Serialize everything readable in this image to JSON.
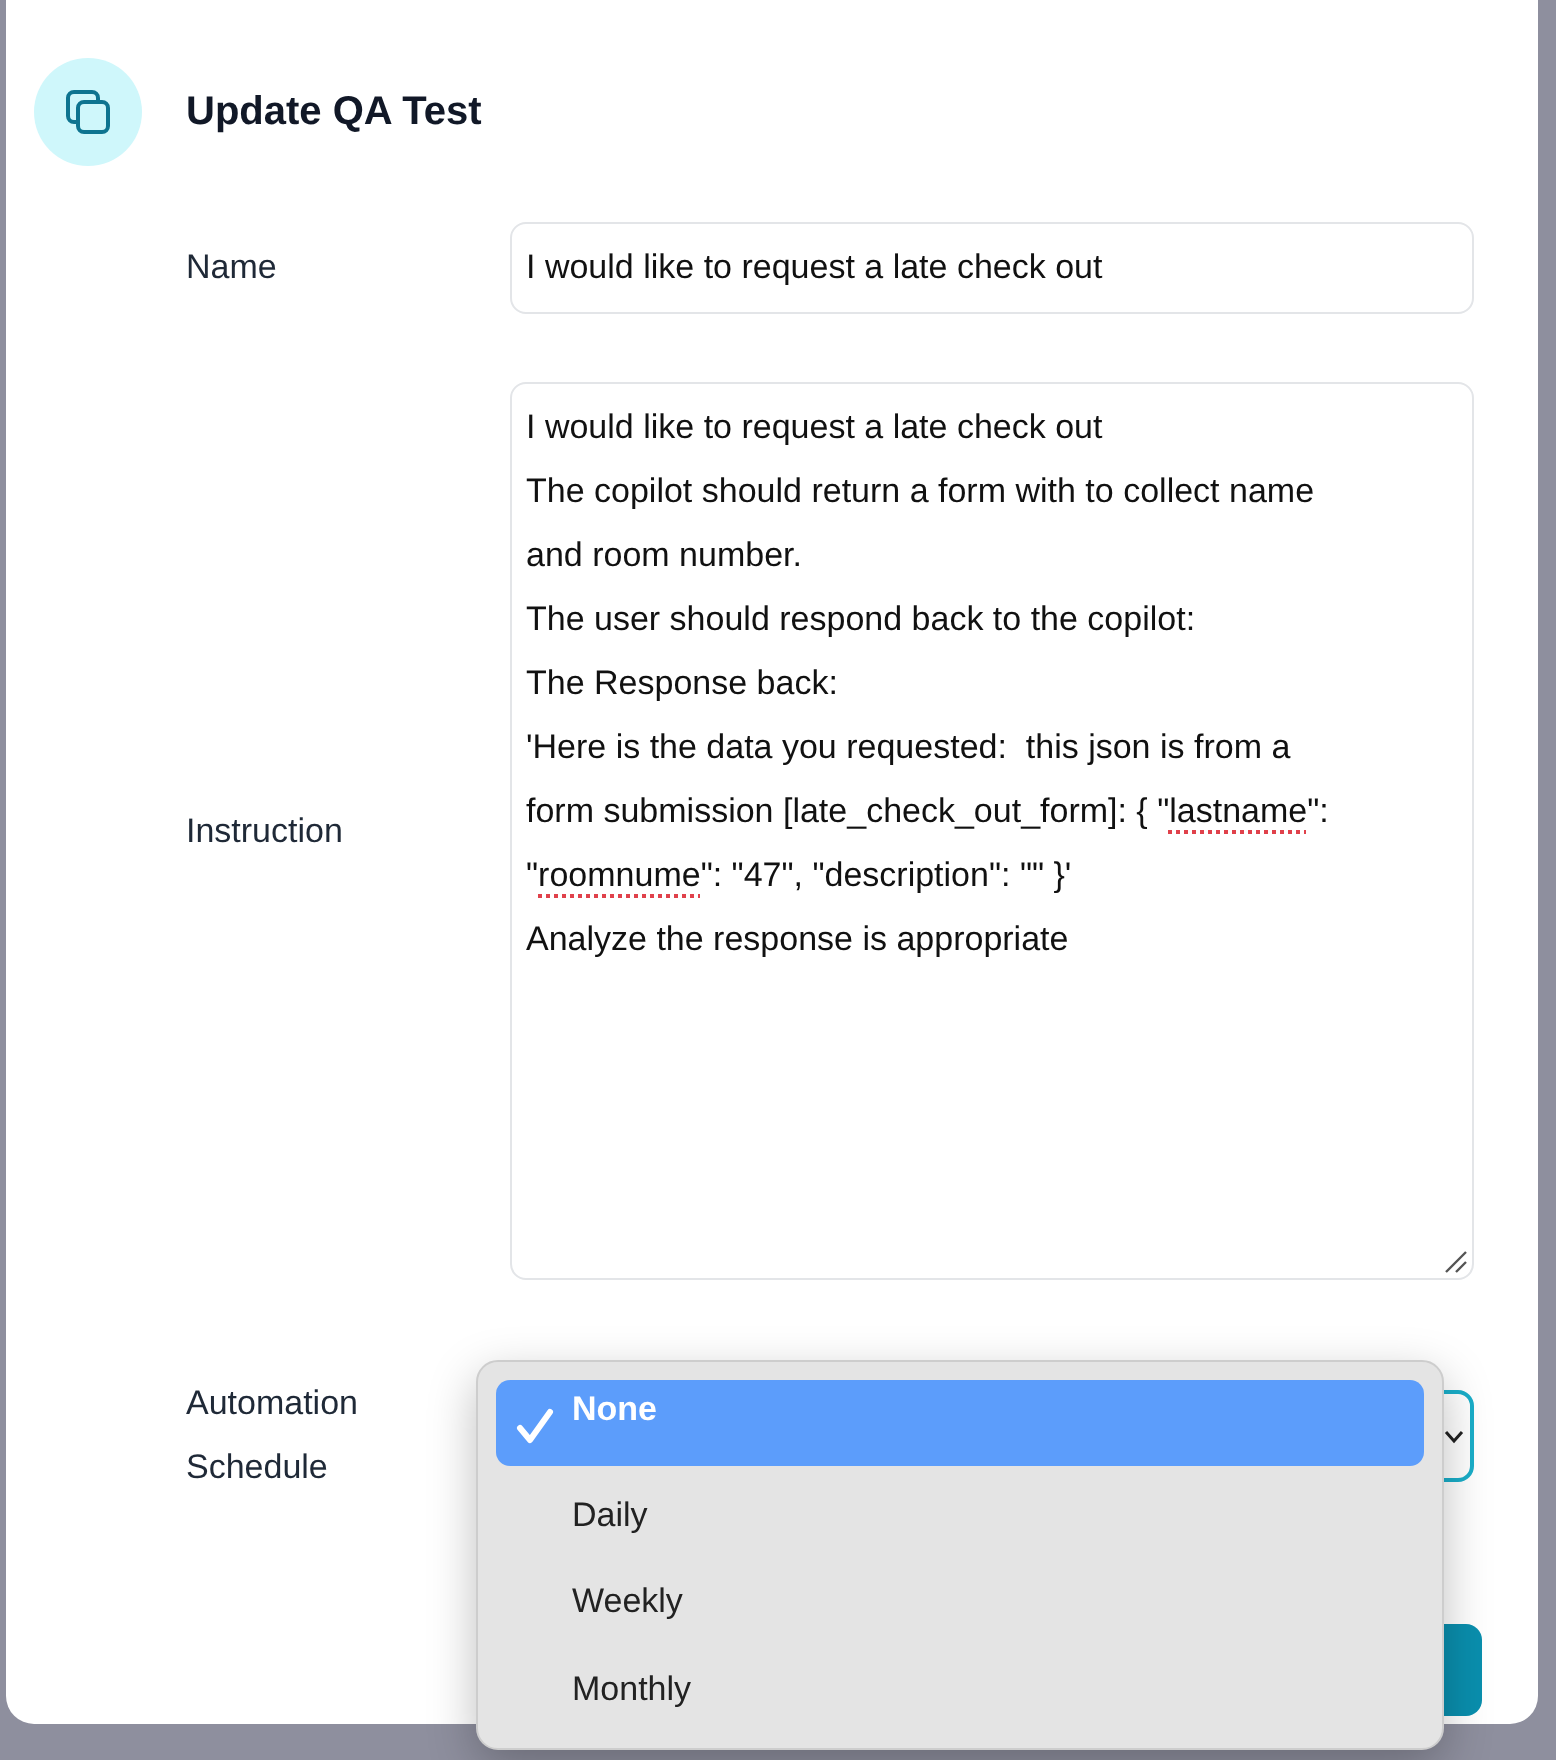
{
  "dialog": {
    "title": "Update QA Test"
  },
  "fields": [
    {
      "kind": "input",
      "label": "Name",
      "value": "I would like to request a late check out"
    },
    {
      "kind": "textarea",
      "label": "Instruction",
      "lines": [
        [
          {
            "text": "I would like to request a late check out",
            "misspelled": false
          }
        ],
        [
          {
            "text": "The copilot should return a form with to collect name",
            "misspelled": false
          }
        ],
        [
          {
            "text": "and room number.",
            "misspelled": false
          }
        ],
        [
          {
            "text": "The user should respond back to the copilot:",
            "misspelled": false
          }
        ],
        [
          {
            "text": "The Response back:",
            "misspelled": false
          }
        ],
        [
          {
            "text": "'Here is the data you requested:  this json is from a",
            "misspelled": false
          }
        ],
        [
          {
            "text": "form submission [late_check_out_form]: { \"",
            "misspelled": false
          },
          {
            "text": "lastname",
            "misspelled": true
          },
          {
            "text": "\":",
            "misspelled": false
          }
        ],
        [
          {
            "text": "\"",
            "misspelled": false
          },
          {
            "text": "roomnume",
            "misspelled": true
          },
          {
            "text": "\": \"47\", \"description\": \"\" }'",
            "misspelled": false
          }
        ],
        [
          {
            "text": "Analyze the response is appropriate",
            "misspelled": false
          }
        ]
      ]
    },
    {
      "kind": "select",
      "label": "Automation Schedule",
      "focused": true
    }
  ],
  "dropdown_menu": {
    "options": [
      {
        "label": "None",
        "selected": true
      },
      {
        "label": "Daily",
        "selected": false
      },
      {
        "label": "Weekly",
        "selected": false
      },
      {
        "label": "Monthly",
        "selected": false
      }
    ]
  }
}
